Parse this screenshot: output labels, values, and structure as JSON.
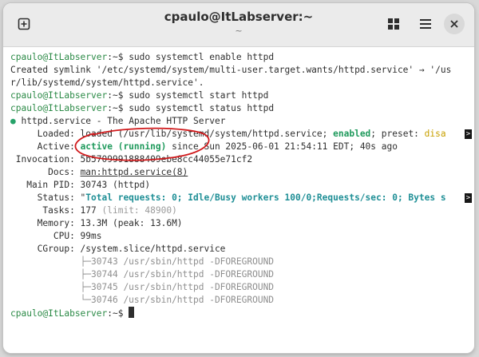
{
  "window": {
    "title": "cpaulo@ItLabserver:~",
    "subtitle": "~",
    "icons": [
      "new-tab-icon",
      "grid-icon",
      "hamburger-menu-icon",
      "close-icon"
    ]
  },
  "terminal": {
    "l1_prompt": "cpaulo@ItLabserver",
    "l1_rest": ":~$ sudo systemctl enable httpd",
    "l2": "Created symlink '/etc/systemd/system/multi-user.target.wants/httpd.service' → '/us",
    "l3": "r/lib/systemd/system/httpd.service'.",
    "l4_prompt": "cpaulo@ItLabserver",
    "l4_rest": ":~$ sudo systemctl start httpd",
    "l5_prompt": "cpaulo@ItLabserver",
    "l5_rest": ":~$ sudo systemctl status httpd",
    "svc_dot": "●",
    "svc_line": " httpd.service - The Apache HTTP Server",
    "loaded_a": "     Loaded: loaded (/usr/lib/systemd/system/httpd.service; ",
    "loaded_enabled": "enabled",
    "loaded_b": "; preset: ",
    "loaded_preset": "disa",
    "active_a": "     Active: ",
    "active_state": "active (running)",
    "active_b": " since Sun 2025-06-01 21:54:11 EDT; 40s ago",
    "invocation": " Invocation: 5b5709991888409ebe8cc44055e71cf2",
    "docs_a": "       Docs: ",
    "docs_link": "man:httpd.service(8)",
    "mainpid": "   Main PID: 30743 (httpd)",
    "status_a": "     Status: \"",
    "status_b": "Total requests: 0; Idle/Busy workers 100/0;Requests/sec: 0; Bytes s",
    "tasks_a": "      Tasks: 177 ",
    "tasks_limit": "(limit: 48900)",
    "memory": "     Memory: 13.3M (peak: 13.6M)",
    "cpu": "        CPU: 99ms",
    "cgroup": "     CGroup: /system.slice/httpd.service",
    "procs": [
      "├─30743 /usr/sbin/httpd -DFOREGROUND",
      "├─30744 /usr/sbin/httpd -DFOREGROUND",
      "├─30745 /usr/sbin/httpd -DFOREGROUND",
      "└─30746 /usr/sbin/httpd -DFOREGROUND"
    ],
    "last_prompt": "cpaulo@ItLabserver",
    "last_rest": ":~$ ",
    "trunc_marker": ">"
  },
  "colors": {
    "prompt": "#2b8a46",
    "enabled": "#1f9a5c",
    "preset": "#c8a000",
    "status_text": "#1f8f96",
    "annotation": "#d0191b"
  }
}
